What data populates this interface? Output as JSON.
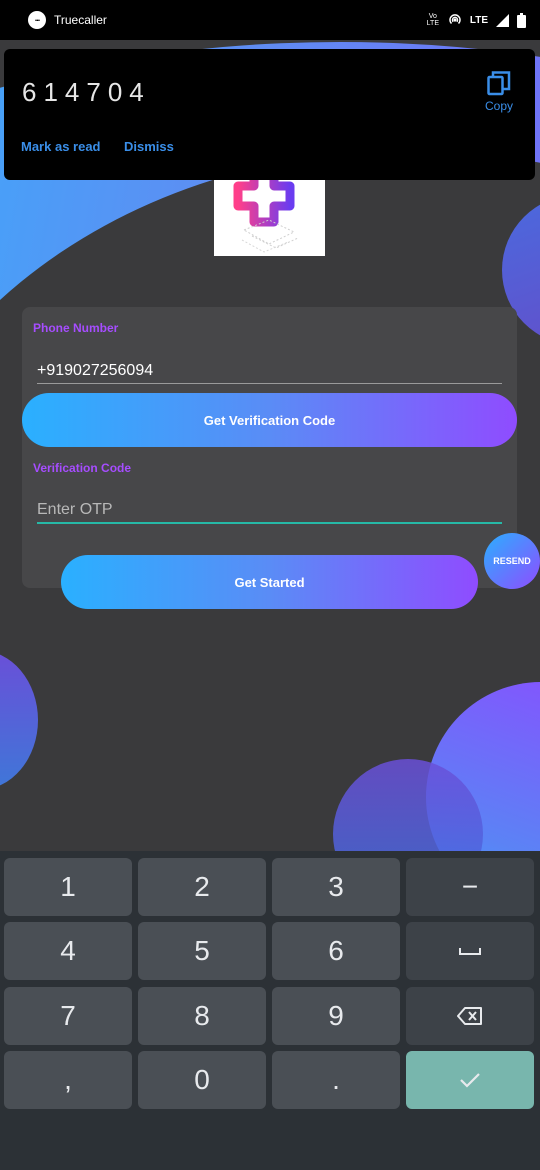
{
  "status_bar": {
    "app_name": "Truecaller",
    "volte": "Vo LTE",
    "lte": "LTE",
    "icons": [
      "message-icon",
      "hotspot-icon",
      "signal-icon",
      "battery-icon"
    ]
  },
  "notification": {
    "code": "614704",
    "copy_label": "Copy",
    "mark_as_read_label": "Mark as read",
    "dismiss_label": "Dismiss"
  },
  "form": {
    "phone_label": "Phone Number",
    "phone_value": "+919027256094",
    "get_code_label": "Get Verification Code",
    "otp_label": "Verification Code",
    "otp_placeholder": "Enter OTP",
    "otp_value": "",
    "resend_label": "RESEND",
    "get_started_label": "Get Started"
  },
  "keyboard": {
    "keys": [
      "1",
      "2",
      "3",
      "−",
      "4",
      "5",
      "6",
      "␣",
      "7",
      "8",
      "9",
      "⌫",
      ",",
      "0",
      ".",
      "✓"
    ],
    "icons": [
      "collapse-keyboard-icon",
      "keyboard-switch-icon"
    ]
  },
  "colors": {
    "accent_purple": "#a64dff",
    "accent_blue": "#2ab0ff",
    "focus_teal": "#26b9a7",
    "card_bg": "#474749",
    "page_bg": "#3a3a3c",
    "link_blue": "#3a8ee8"
  }
}
